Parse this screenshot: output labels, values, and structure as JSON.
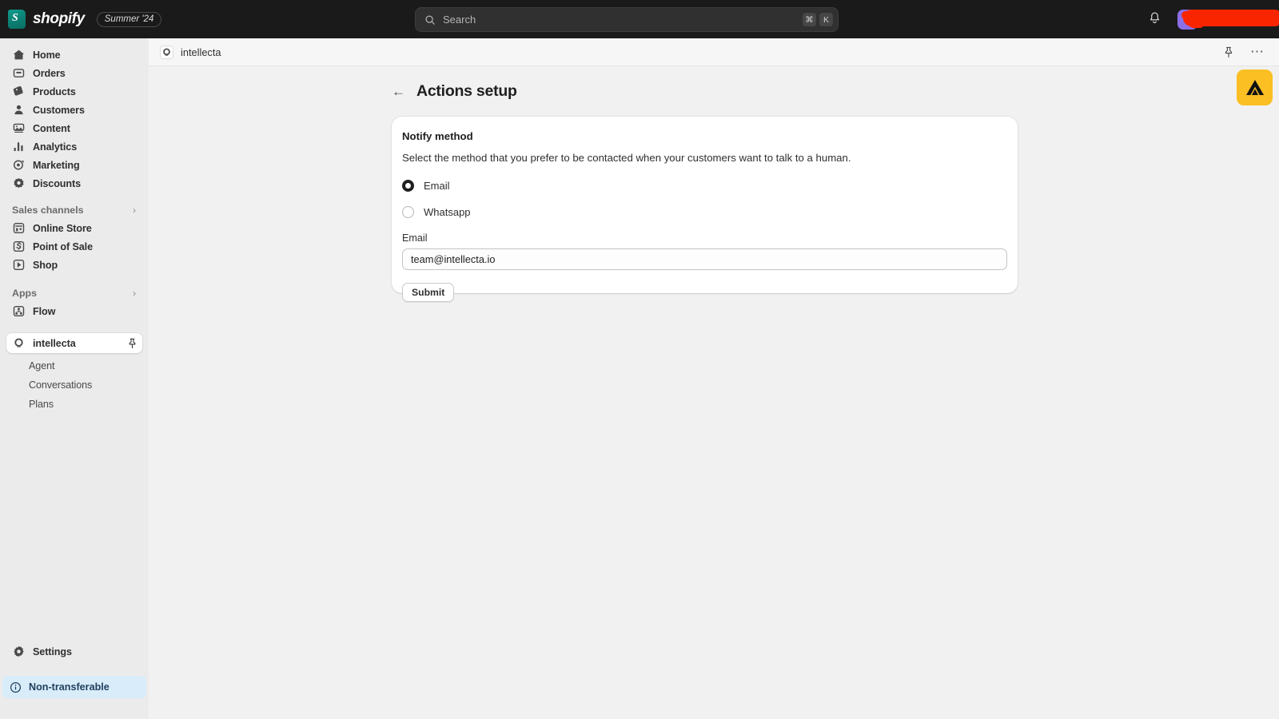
{
  "topbar": {
    "brand_name": "shopify",
    "brand_icon": "shopify-bag-icon",
    "season_chip": "Summer '24",
    "search": {
      "placeholder": "Search",
      "icon": "search-icon",
      "shortcut_modifier": "⌘",
      "shortcut_key": "K"
    },
    "bell_icon": "notification-bell-icon",
    "avatar_color": "#8b6fe8",
    "annotation_color": "#f92500"
  },
  "sidebar": {
    "primary_items": [
      {
        "label": "Home",
        "icon": "home-icon"
      },
      {
        "label": "Orders",
        "icon": "orders-inbox-icon"
      },
      {
        "label": "Products",
        "icon": "products-tag-icon"
      },
      {
        "label": "Customers",
        "icon": "customers-person-icon"
      },
      {
        "label": "Content",
        "icon": "content-media-icon"
      },
      {
        "label": "Analytics",
        "icon": "analytics-bars-icon"
      },
      {
        "label": "Marketing",
        "icon": "marketing-target-icon"
      },
      {
        "label": "Discounts",
        "icon": "discounts-badge-icon"
      }
    ],
    "sales_channels": {
      "header": "Sales channels",
      "chevron": "chevron-right-icon",
      "items": [
        {
          "label": "Online Store",
          "icon": "storefront-icon"
        },
        {
          "label": "Point of Sale",
          "icon": "point-of-sale-icon"
        },
        {
          "label": "Shop",
          "icon": "shop-icon"
        }
      ]
    },
    "apps": {
      "header": "Apps",
      "chevron": "chevron-right-icon",
      "items": [
        {
          "label": "Flow",
          "icon": "flow-icon"
        }
      ]
    },
    "app_section": {
      "active_label": "intellecta",
      "active_icon": "intellecta-logo-icon",
      "pin_icon": "pin-icon",
      "sub_items": [
        {
          "label": "Agent"
        },
        {
          "label": "Conversations"
        },
        {
          "label": "Plans"
        }
      ]
    },
    "settings": {
      "label": "Settings",
      "icon": "gear-icon"
    },
    "status_badge": {
      "label": "Non-transferable",
      "icon": "info-circle-icon",
      "background": "#d8ecfa",
      "text_color": "#1f3f5c"
    }
  },
  "breadcrumb": {
    "app_name": "intellecta",
    "app_icon": "intellecta-logo-icon",
    "pin_icon": "pin-icon",
    "more_icon": "more-horizontal-icon"
  },
  "page": {
    "back_icon": "arrow-left-icon",
    "title": "Actions setup"
  },
  "card": {
    "title": "Notify method",
    "description": "Select the method that you prefer to be contacted when your customers want to talk to a human.",
    "options": [
      {
        "label": "Email",
        "selected": true
      },
      {
        "label": "Whatsapp",
        "selected": false
      }
    ],
    "field_label": "Email",
    "field_value": "team@intellecta.io",
    "field_placeholder": "team@intellecta.io",
    "submit_label": "Submit"
  },
  "floating_badge": {
    "icon": "mountain-triangle-icon",
    "background": "#fbbf24"
  }
}
